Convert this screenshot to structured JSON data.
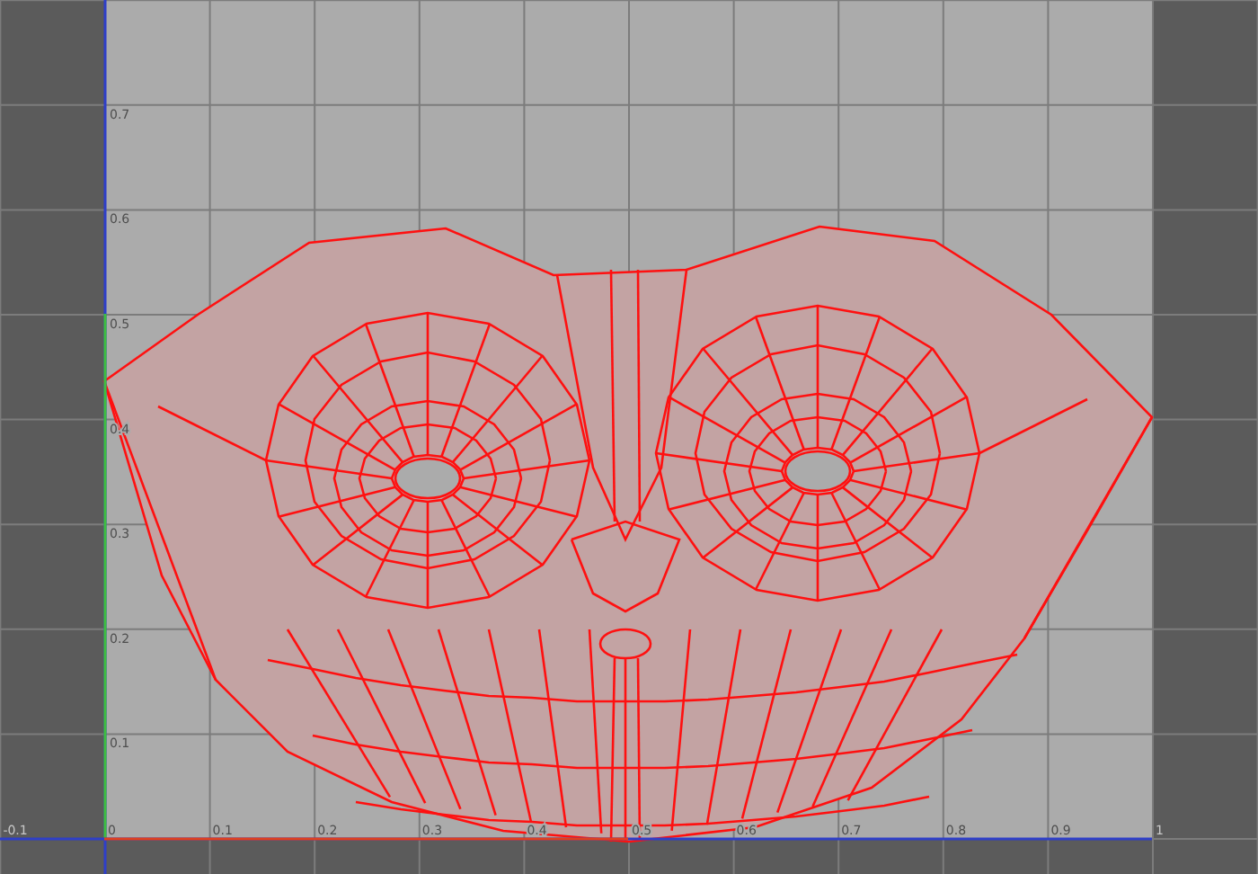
{
  "uv_editor": {
    "u_axis_labels": [
      "-0.1",
      "0",
      "0.1",
      "0.2",
      "0.3",
      "0.4",
      "0.5",
      "0.6",
      "0.7",
      "0.8",
      "0.9",
      "1"
    ],
    "v_axis_labels": [
      "0.7",
      "0.6",
      "0.5",
      "0.4",
      "0.3",
      "0.2",
      "0.1"
    ]
  }
}
